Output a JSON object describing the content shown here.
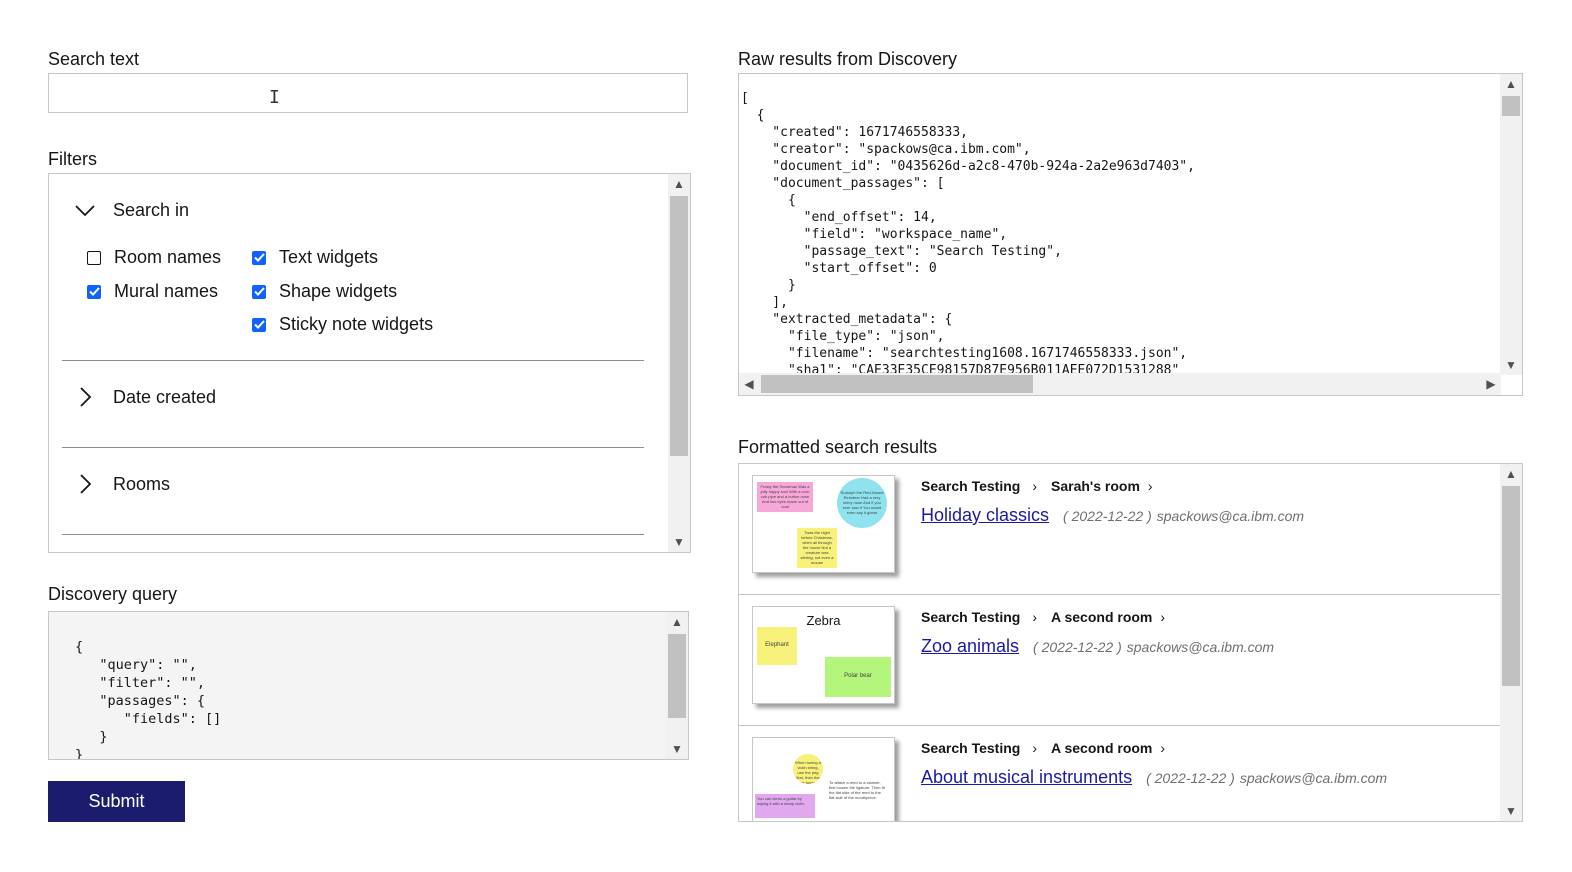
{
  "search": {
    "label": "Search text",
    "value": "",
    "placeholder": ""
  },
  "filters": {
    "label": "Filters",
    "sections": [
      {
        "title": "Search in",
        "expanded": true
      },
      {
        "title": "Date created",
        "expanded": false
      },
      {
        "title": "Rooms",
        "expanded": false
      }
    ],
    "checkboxes": [
      {
        "label": "Room names",
        "checked": false
      },
      {
        "label": "Mural names",
        "checked": true
      },
      {
        "label": "Text widgets",
        "checked": true
      },
      {
        "label": "Shape widgets",
        "checked": true
      },
      {
        "label": "Sticky note widgets",
        "checked": true
      }
    ]
  },
  "query": {
    "label": "Discovery query",
    "text": "{\n   \"query\": \"\",\n   \"filter\": \"\",\n   \"passages\": {\n      \"fields\": []\n   }\n}"
  },
  "submit": {
    "label": "Submit"
  },
  "raw": {
    "label": "Raw results from Discovery",
    "text": "[\n  {\n    \"created\": 1671746558333,\n    \"creator\": \"spackows@ca.ibm.com\",\n    \"document_id\": \"0435626d-a2c8-470b-924a-2a2e963d7403\",\n    \"document_passages\": [\n      {\n        \"end_offset\": 14,\n        \"field\": \"workspace_name\",\n        \"passage_text\": \"Search Testing\",\n        \"start_offset\": 0\n      }\n    ],\n    \"extracted_metadata\": {\n      \"file_type\": \"json\",\n      \"filename\": \"searchtesting1608.1671746558333.json\",\n      \"sha1\": \"CAE33E35CE98157D87E956B011AEE072D1531288\""
  },
  "formatted": {
    "label": "Formatted search results",
    "results": [
      {
        "workspace": "Search Testing",
        "room": "Sarah's room",
        "title": "Holiday classics",
        "date": "( 2022-12-22 )",
        "creator": "spackows@ca.ibm.com",
        "notes": [
          "Frosty the Snowman Was a jolly happy soul With a corn cob pipe and a button nose And two eyes made out of coal",
          "Rudolph the Red-Nosed Reindeer Had a very shiny nose And if you ever saw it You would even say it glows",
          "Twas the night before Christmas, when all through the house Not a creature was stirring, not even a mouse"
        ]
      },
      {
        "workspace": "Search Testing",
        "room": "A second room",
        "title": "Zoo animals",
        "date": "( 2022-12-22 )",
        "creator": "spackows@ca.ibm.com",
        "heading": "Zebra",
        "notes": [
          "Elephant",
          "Polar bear"
        ]
      },
      {
        "workspace": "Search Testing",
        "room": "A second room",
        "title": "About musical instruments",
        "date": "( 2022-12-22 )",
        "creator": "spackows@ca.ibm.com",
        "notes": [
          "When tuning a violin string, use the peg first, then the fine tuner if there is one",
          "To attach a reed to a clarinet, first loosen the ligature. Then fit the flat side of the reed to the flat side of the mouthpiece.",
          "You can clean a guitar by wiping it with a damp cloth."
        ]
      }
    ]
  },
  "colors": {
    "accent": "#0f62fe",
    "submit_bg": "#1c1c6e",
    "link": "#1a1aa6"
  }
}
